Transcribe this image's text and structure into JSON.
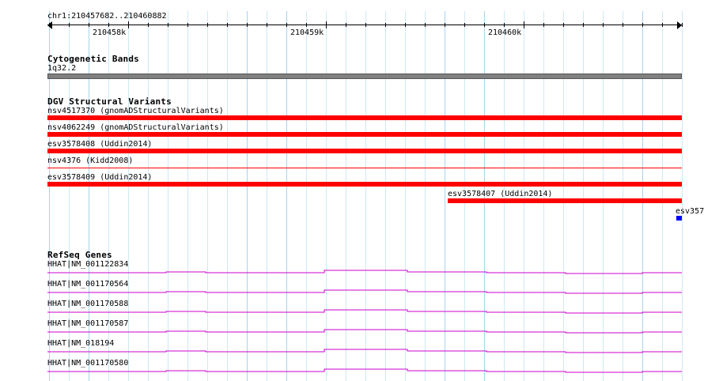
{
  "ruler": {
    "location": "chr1:210457682..210460882",
    "ticks": [
      "210458k",
      "210459k",
      "210460k"
    ]
  },
  "tracks": {
    "cytoband": {
      "title": "Cytogenetic Bands",
      "band_label": "1q32.2",
      "band_color": "#808080"
    },
    "dgv": {
      "title": "DGV Structural Variants",
      "feature_color": "#ff0000",
      "partial_feature_color": "#0000ff",
      "features": [
        {
          "label": "nsv4517370 (gnomADStructuralVariants)",
          "style": "bar"
        },
        {
          "label": "nsv4062249 (gnomADStructuralVariants)",
          "style": "bar"
        },
        {
          "label": "esv3578408 (Uddin2014)",
          "style": "bar"
        },
        {
          "label": "nsv4376 (Kidd2008)",
          "style": "thin"
        },
        {
          "label": "esv3578409 (Uddin2014)",
          "style": "bar"
        },
        {
          "label": "esv3578407 (Uddin2014)",
          "style": "bar"
        },
        {
          "label": "esv357",
          "style": "small"
        }
      ]
    },
    "refseq": {
      "title": "RefSeq Genes",
      "gene_color": "#cc00cc",
      "genes": [
        {
          "label": "HHAT|NM_001122834"
        },
        {
          "label": "HHAT|NM_001170564"
        },
        {
          "label": "HHAT|NM_001170588"
        },
        {
          "label": "HHAT|NM_001170587"
        },
        {
          "label": "HHAT|NM_018194"
        },
        {
          "label": "HHAT|NM_001170580"
        }
      ]
    }
  }
}
